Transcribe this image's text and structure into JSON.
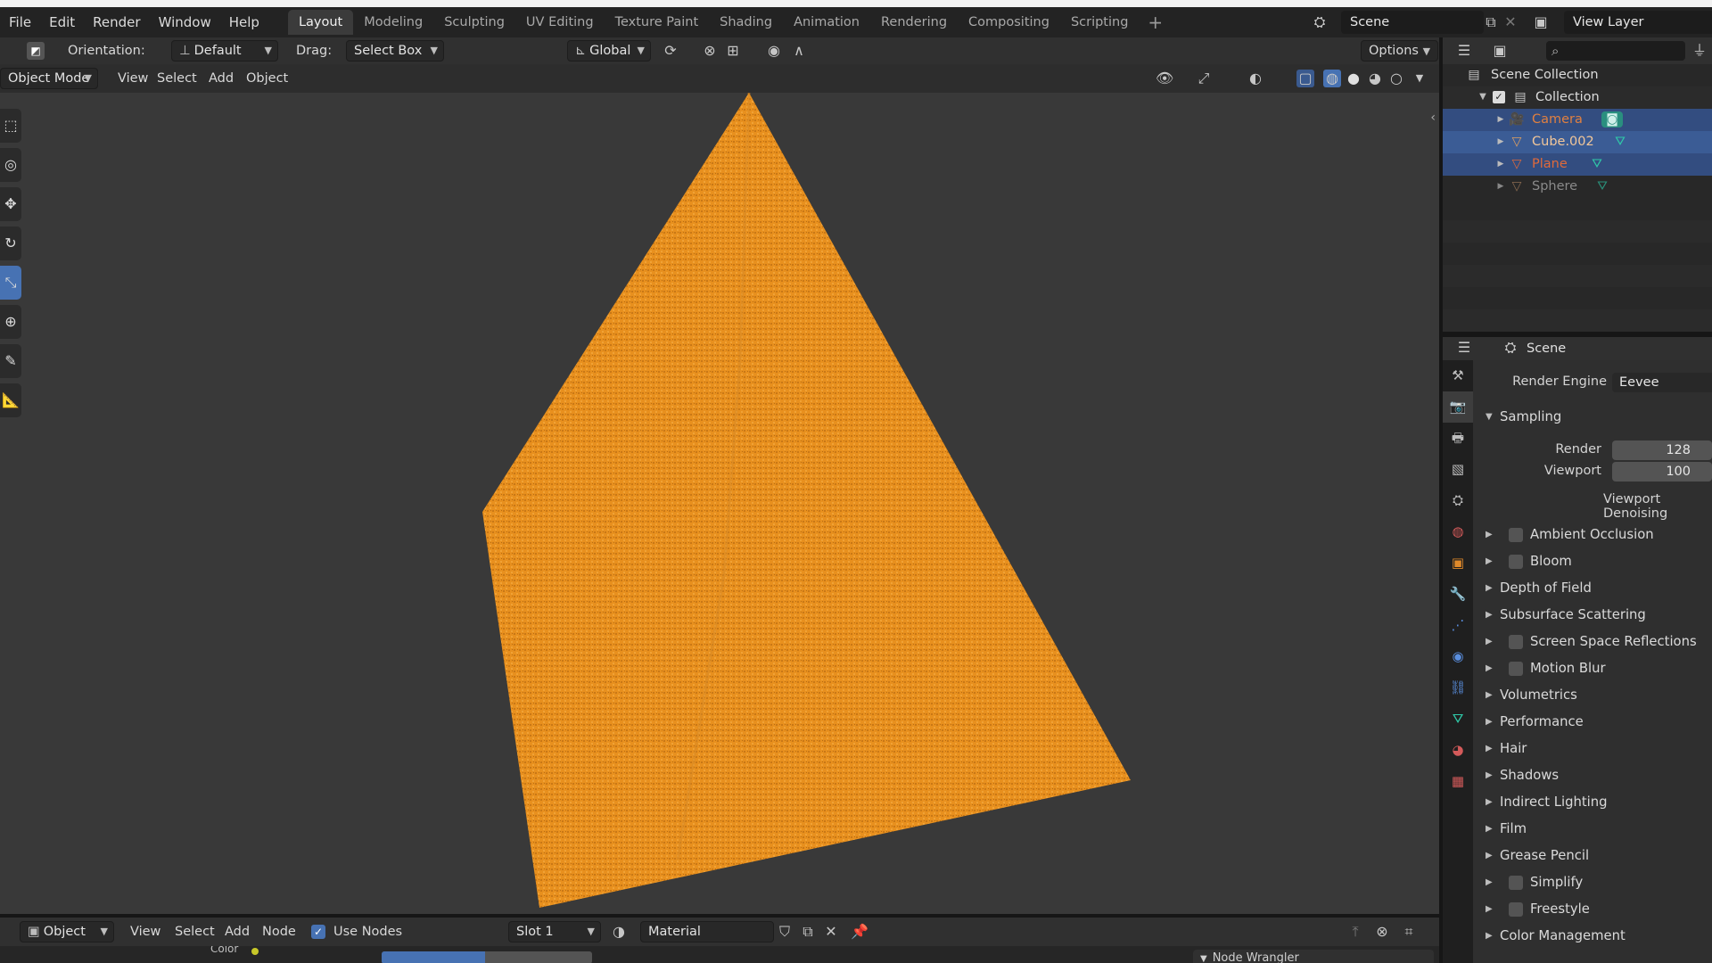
{
  "menubar": {
    "items": [
      "File",
      "Edit",
      "Render",
      "Window",
      "Help"
    ],
    "workspaces": [
      "Layout",
      "Modeling",
      "Sculpting",
      "UV Editing",
      "Texture Paint",
      "Shading",
      "Animation",
      "Rendering",
      "Compositing",
      "Scripting"
    ],
    "active_workspace": "Layout",
    "add_tab": "+",
    "scene": "Scene",
    "view_layer": "View Layer"
  },
  "viewport_header": {
    "orientation_label": "Orientation:",
    "orientation_value": "Default",
    "drag_label": "Drag:",
    "drag_value": "Select Box",
    "transform_value": "Global",
    "options": "Options",
    "mode": "Object Mode",
    "menus": [
      "View",
      "Select",
      "Add",
      "Object"
    ]
  },
  "node_editor": {
    "type_value": "Object",
    "menus": [
      "View",
      "Select",
      "Add",
      "Node"
    ],
    "use_nodes": "Use Nodes",
    "slot": "Slot 1",
    "material": "Material",
    "partial_labels": [
      "Color",
      "Node Wrangler"
    ]
  },
  "outliner": {
    "root": "Scene Collection",
    "collection": "Collection",
    "items": [
      {
        "name": "Camera",
        "color": "#e08040",
        "selected": true
      },
      {
        "name": "Cube.002",
        "color": "#e0a060",
        "selected": true
      },
      {
        "name": "Plane",
        "color": "#e06a3a",
        "selected": true
      },
      {
        "name": "Sphere",
        "color": "#8a8a8a",
        "selected": false
      }
    ]
  },
  "properties": {
    "context": "Scene",
    "render_engine_label": "Render Engine",
    "render_engine_value": "Eevee",
    "sampling": "Sampling",
    "render_label": "Render",
    "render_value": "128",
    "viewport_label": "Viewport",
    "viewport_value": "100",
    "viewport_denoising": "Viewport Denoising",
    "panels": [
      {
        "label": "Ambient Occlusion",
        "checkbox": true
      },
      {
        "label": "Bloom",
        "checkbox": true
      },
      {
        "label": "Depth of Field",
        "checkbox": false
      },
      {
        "label": "Subsurface Scattering",
        "checkbox": false
      },
      {
        "label": "Screen Space Reflections",
        "checkbox": true
      },
      {
        "label": "Motion Blur",
        "checkbox": true
      },
      {
        "label": "Volumetrics",
        "checkbox": false
      },
      {
        "label": "Performance",
        "checkbox": false
      },
      {
        "label": "Hair",
        "checkbox": false
      },
      {
        "label": "Shadows",
        "checkbox": false
      },
      {
        "label": "Indirect Lighting",
        "checkbox": false
      },
      {
        "label": "Film",
        "checkbox": false
      },
      {
        "label": "Grease Pencil",
        "checkbox": false
      },
      {
        "label": "Simplify",
        "checkbox": true
      },
      {
        "label": "Freestyle",
        "checkbox": true
      },
      {
        "label": "Color Management",
        "checkbox": false
      }
    ]
  },
  "colors": {
    "accent": "#4772b3",
    "object_orange": "#e8901e",
    "selection": "#334d80"
  }
}
